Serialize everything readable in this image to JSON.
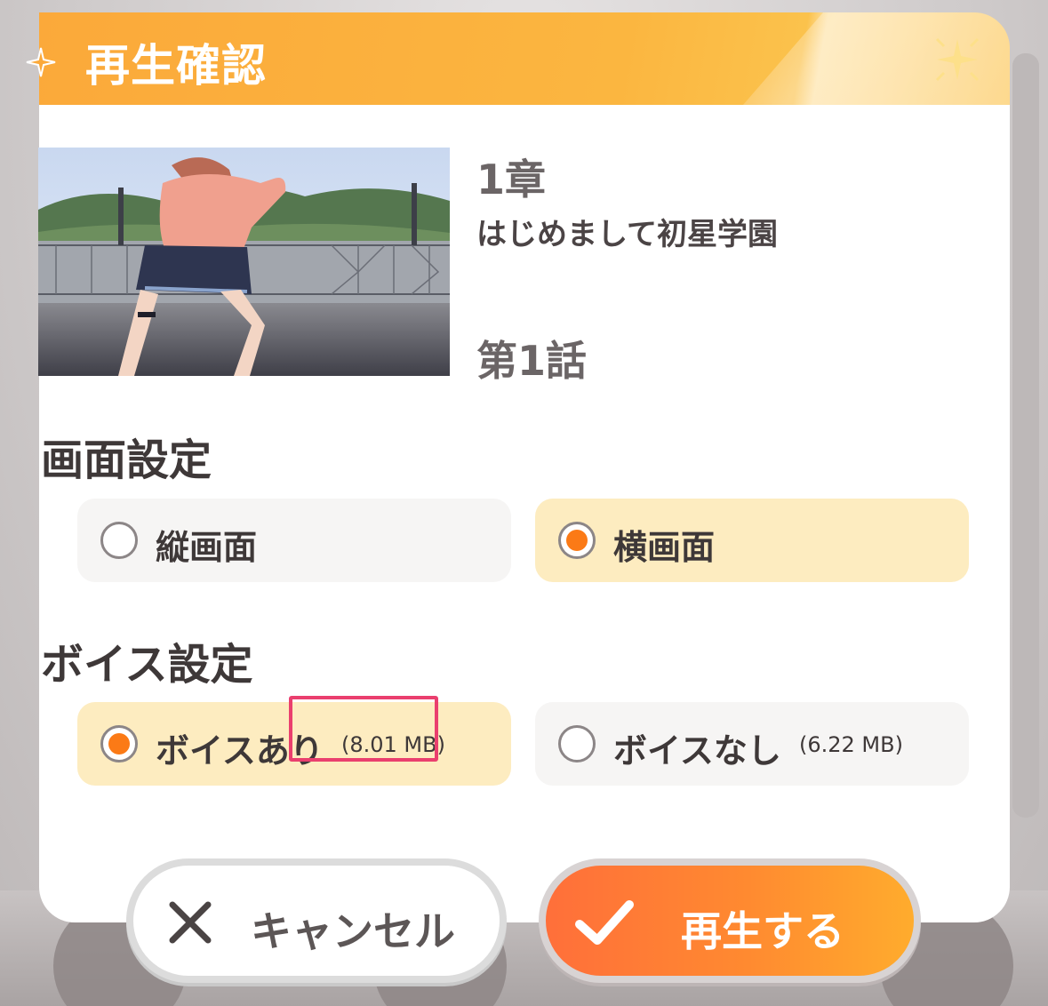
{
  "dialog": {
    "title": "再生確認"
  },
  "story": {
    "chapter": "1章",
    "chapter_title": "はじめまして初星学園",
    "episode": "第1話"
  },
  "screen_settings": {
    "title": "画面設定",
    "options": [
      {
        "label": "縦画面",
        "selected": false
      },
      {
        "label": "横画面",
        "selected": true
      }
    ]
  },
  "voice_settings": {
    "title": "ボイス設定",
    "options": [
      {
        "label": "ボイスあり",
        "size": "(8.01 MB)",
        "selected": true
      },
      {
        "label": "ボイスなし",
        "size": "(6.22 MB)",
        "selected": false
      }
    ]
  },
  "buttons": {
    "cancel_label": "キャンセル",
    "play_label": "再生する"
  },
  "colors": {
    "accent_orange": "#fb7a16",
    "header_orange": "#fba93a",
    "selected_bg": "#fdecc0",
    "highlight": "#ea3f6e"
  },
  "icons": {
    "cancel": "close-icon",
    "play": "check-icon",
    "header_left": "sparkle-icon",
    "header_right": "sparkle-icon"
  }
}
